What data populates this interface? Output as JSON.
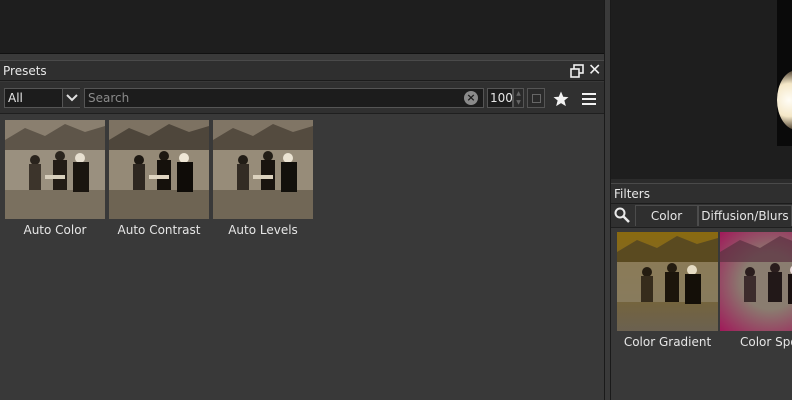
{
  "presets_panel": {
    "title": "Presets",
    "category": "All",
    "search_placeholder": "Search",
    "thumbnail_size": "100",
    "items": [
      {
        "label": "Auto Color"
      },
      {
        "label": "Auto Contrast"
      },
      {
        "label": "Auto Levels"
      }
    ]
  },
  "filters_panel": {
    "title": "Filters",
    "tabs": [
      {
        "label": "Color"
      },
      {
        "label": "Diffusion/Blurs"
      }
    ],
    "items": [
      {
        "label": "Color Gradient"
      },
      {
        "label": "Color Spo"
      }
    ]
  },
  "icons": {
    "restore": "window-restore-icon",
    "close": "close-icon",
    "dropdown": "chevron-down-icon",
    "clear": "clear-search-icon",
    "favorites": "star-icon",
    "menu": "hamburger-menu-icon",
    "filter_search": "magnifier-icon"
  },
  "colors": {
    "panel_bg": "#393939",
    "header_bg": "#2f2f2f",
    "field_bg": "#1c1c1c"
  }
}
